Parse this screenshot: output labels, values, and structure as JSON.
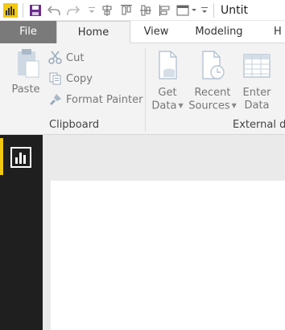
{
  "window": {
    "title": "Untit"
  },
  "tabs": {
    "file": "File",
    "home": "Home",
    "view": "View",
    "modeling": "Modeling",
    "help": "H"
  },
  "clipboard": {
    "paste": "Paste",
    "cut": "Cut",
    "copy": "Copy",
    "format_painter": "Format Painter",
    "group_label": "Clipboard"
  },
  "external_data": {
    "get_data_line1": "Get",
    "get_data_line2": "Data",
    "recent_line1": "Recent",
    "recent_line2": "Sources",
    "enter_line1": "Enter",
    "enter_line2": "Data",
    "group_label": "External da"
  },
  "icons": {
    "app": "powerbi-logo-icon",
    "save": "save-icon",
    "undo": "undo-icon",
    "redo": "redo-icon",
    "report": "report-view-icon"
  },
  "colors": {
    "accent_yellow": "#f2c811",
    "file_tab": "#7a7a7a",
    "sidebar": "#1f1f1f",
    "save_purple": "#6b2c8f"
  }
}
